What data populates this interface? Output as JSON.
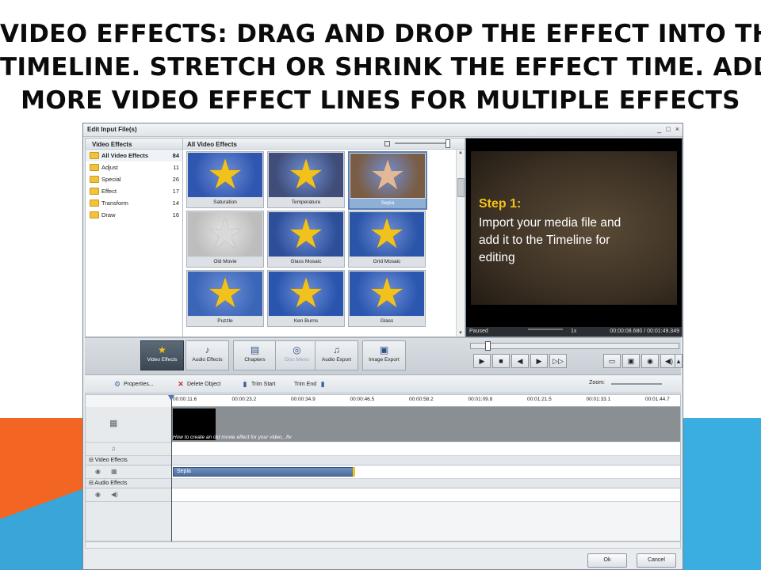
{
  "slide": {
    "title_lines": [
      "VIDEO EFFECTS: DRAG AND DROP THE EFFECT INTO THE",
      "TIMELINE. STRETCH OR SHRINK THE EFFECT TIME. ADD",
      "MORE VIDEO EFFECT LINES FOR MULTIPLE EFFECTS"
    ],
    "accent_orange": "#f26522",
    "accent_blue": "#3aaee0"
  },
  "window": {
    "title": "Edit Input File(s)",
    "controls": [
      "_",
      "□",
      "×"
    ]
  },
  "library": {
    "header": "Video Effects",
    "categories": [
      {
        "label": "All Video Effects",
        "count": "84",
        "selected": true
      },
      {
        "label": "Adjust",
        "count": "11"
      },
      {
        "label": "Special",
        "count": "26"
      },
      {
        "label": "Effect",
        "count": "17"
      },
      {
        "label": "Transform",
        "count": "14"
      },
      {
        "label": "Draw",
        "count": "16"
      }
    ]
  },
  "effects_grid": {
    "header": "All Video Effects",
    "tiles": [
      {
        "label": "Saturation",
        "bg": "#2f56b0"
      },
      {
        "label": "Temperature",
        "bg": "#3f4d78"
      },
      {
        "label": "Sepia",
        "bg": "#7a5d45",
        "selected": true
      },
      {
        "label": "Old Movie",
        "bg": "#bdbdbd"
      },
      {
        "label": "Glass Mosaic",
        "bg": "#2d4f9a"
      },
      {
        "label": "Grid Mosaic",
        "bg": "#2b55a8"
      },
      {
        "label": "Puzzle",
        "bg": "#3b66b8"
      },
      {
        "label": "Ken Burns",
        "bg": "#2a55ae"
      },
      {
        "label": "Glass",
        "bg": "#2b57b0"
      }
    ]
  },
  "preview": {
    "step_title": "Step 1:",
    "step_body": "Import your media file and\nadd it to the Timeline for\nediting",
    "status": "Paused",
    "zoom": "1x",
    "time": "00:00:08.680 / 00:01:49.349"
  },
  "toolbar": {
    "buttons": [
      {
        "label": "Video Effects",
        "icon": "video-effects-icon",
        "glyph": "★",
        "active": true
      },
      {
        "label": "Audio Effects",
        "icon": "audio-effects-icon",
        "glyph": "♪"
      },
      {
        "label": "Chapters",
        "icon": "chapters-icon",
        "glyph": "▤"
      },
      {
        "label": "Disc Menu",
        "icon": "disc-menu-icon",
        "glyph": "◎",
        "disabled": true
      },
      {
        "label": "Audio Export",
        "icon": "audio-export-icon",
        "glyph": "♫"
      },
      {
        "label": "Image Export",
        "icon": "image-export-icon",
        "glyph": "▣"
      }
    ],
    "playback": [
      {
        "name": "play-button",
        "glyph": "▶"
      },
      {
        "name": "stop-button",
        "glyph": "■"
      },
      {
        "name": "previous-frame-button",
        "glyph": "◀"
      },
      {
        "name": "next-frame-button",
        "glyph": "▶"
      },
      {
        "name": "frame-step-button",
        "glyph": "▷▷"
      }
    ],
    "right_tools": [
      {
        "name": "screen-icon",
        "glyph": "▭"
      },
      {
        "name": "crop-icon",
        "glyph": "▣"
      },
      {
        "name": "camera-icon",
        "glyph": "◉"
      },
      {
        "name": "volume-icon",
        "glyph": "◀)"
      },
      {
        "name": "more-icon",
        "glyph": "▴"
      }
    ]
  },
  "timeline_toolbar": {
    "properties": "Properties...",
    "delete": "Delete Object",
    "trim_start": "Trim Start",
    "trim_end": "Trim End",
    "zoom_label": "Zoom:"
  },
  "timeline": {
    "ticks": [
      "00:00:11.6",
      "00:00:23.2",
      "00:00:34.9",
      "00:00:46.5",
      "00:00:58.2",
      "00:01:09.8",
      "00:01:21.5",
      "00:01:33.1",
      "00:01:44.7"
    ],
    "clip_name": "How to create an old movie effect for your video_.flv",
    "video_effects_section": "⊟ Video Effects",
    "audio_effects_section": "⊟ Audio Effects",
    "effect_clip": "Sepia"
  },
  "footer": {
    "ok": "Ok",
    "cancel": "Cancel"
  }
}
